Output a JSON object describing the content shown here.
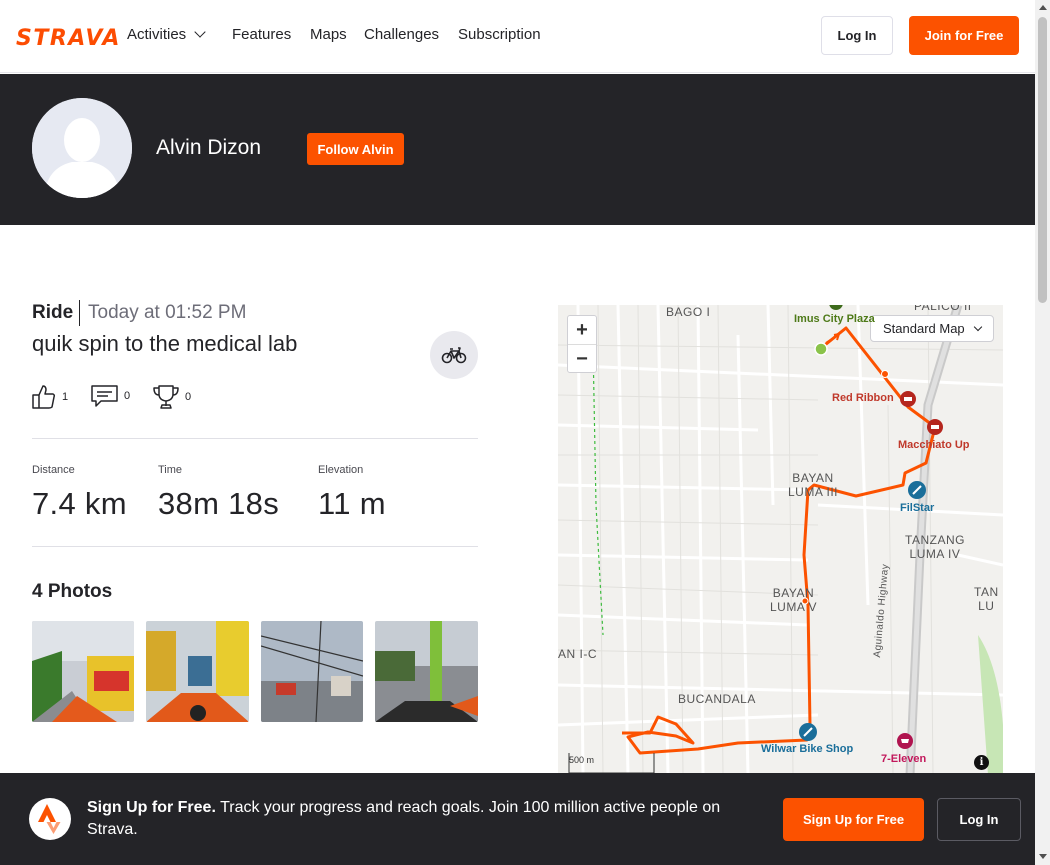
{
  "brand": {
    "logo_text": "STRAVA",
    "accent_color": "#fc5200"
  },
  "nav": {
    "items": [
      {
        "label": "Activities",
        "has_dropdown": true
      },
      {
        "label": "Features"
      },
      {
        "label": "Maps"
      },
      {
        "label": "Challenges"
      },
      {
        "label": "Subscription"
      }
    ],
    "login_label": "Log In",
    "join_label": "Join for Free"
  },
  "profile": {
    "name": "Alvin Dizon",
    "follow_label": "Follow Alvin",
    "avatar_icon": "default-avatar-icon"
  },
  "activity": {
    "type": "Ride",
    "time": "Today at 01:52 PM",
    "title": "quik spin to the medical lab",
    "sport_icon": "bike-icon",
    "kudos_count": "1",
    "comments_count": "0",
    "achievements_count": "0",
    "stats": [
      {
        "label": "Distance",
        "value": "7.4 km"
      },
      {
        "label": "Time",
        "value": "38m 18s"
      },
      {
        "label": "Elevation",
        "value": "11 m"
      }
    ]
  },
  "photos": {
    "title": "4 Photos",
    "count": 4
  },
  "map": {
    "style_selected": "Standard Map",
    "zoom_in_label": "+",
    "zoom_out_label": "−",
    "scale_label": "500 m",
    "info_label": "i",
    "route_color": "#fc5200",
    "area_labels": [
      "BAGO I",
      "PALICO II",
      "BAYAN\nLUMA III",
      "TANZANG\nLUMA IV",
      "BAYAN\nLUMA V",
      "BUCANDALA",
      "AN I-C",
      "TAN\nLU",
      "Aguinaldo Highway"
    ],
    "pois": [
      {
        "label": "Imus City Plaza",
        "color": "#5a8a1c"
      },
      {
        "label": "Red Ribbon",
        "color": "#c0392b"
      },
      {
        "label": "Macchiato Up",
        "color": "#c0392b"
      },
      {
        "label": "FilStar",
        "color": "#1a6e9a"
      },
      {
        "label": "Wilwar Bike Shop",
        "color": "#1a6e9a"
      },
      {
        "label": "7-Eleven",
        "color": "#c2185b"
      }
    ]
  },
  "signup_footer": {
    "headline": "Sign Up for Free.",
    "body": " Track your progress and reach goals. Join 100 million active people on Strava.",
    "signup_label": "Sign Up for Free",
    "login_label": "Log In"
  }
}
